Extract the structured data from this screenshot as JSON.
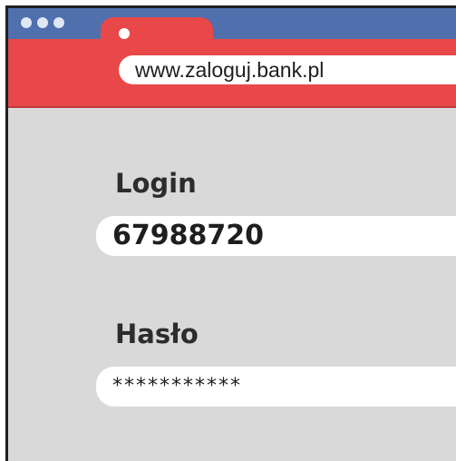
{
  "browser": {
    "address": "www.zaloguj.bank.pl"
  },
  "form": {
    "login_label": "Login",
    "login_value": "67988720",
    "password_label": "Hasło",
    "password_value": "***********"
  },
  "colors": {
    "titlebar": "#4f6fad",
    "tab": "#e84848",
    "page_background": "#d9d9d9"
  }
}
